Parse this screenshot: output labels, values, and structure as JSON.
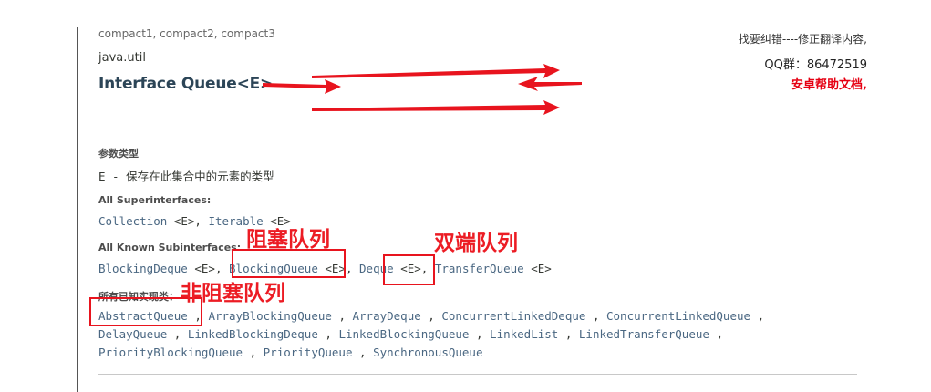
{
  "doc": {
    "profiles_text": "compact1, compact2, compact3",
    "package": "java.util",
    "title": "Interface Queue<E>",
    "type_params_label": "参数类型",
    "type_param": "E",
    "type_param_sep": " - ",
    "type_param_desc": "保存在此集合中的元素的类型",
    "superinterfaces_label": "All Superinterfaces:",
    "superinterfaces": [
      "Collection",
      "Iterable"
    ],
    "subinterfaces_label": "All Known Subinterfaces:",
    "subinterfaces": [
      "BlockingDeque",
      "BlockingQueue",
      "Deque",
      "TransferQueue"
    ],
    "implementing_label": "所有已知实现类：",
    "implementing_classes": [
      "AbstractQueue",
      "ArrayBlockingQueue",
      "ArrayDeque",
      "ConcurrentLinkedDeque",
      "ConcurrentLinkedQueue",
      "DelayQueue",
      "LinkedBlockingDeque",
      "LinkedBlockingQueue",
      "LinkedList",
      "LinkedTransferQueue",
      "PriorityBlockingQueue",
      "PriorityQueue",
      "SynchronousQueue"
    ],
    "generic_suffix": "<E>",
    "separator": ","
  },
  "corner": {
    "line1": "找要纠错----修正翻译内容,",
    "line2": "QQ群：86472519",
    "line3": "安卓帮助文档,"
  },
  "annotations": {
    "blocking": "阻塞队列",
    "deque": "双端队列",
    "nonblocking": "非阻塞队列"
  },
  "colors": {
    "annotation_red": "#ec1c24",
    "link": "#4a6782",
    "title": "#2c4557"
  }
}
